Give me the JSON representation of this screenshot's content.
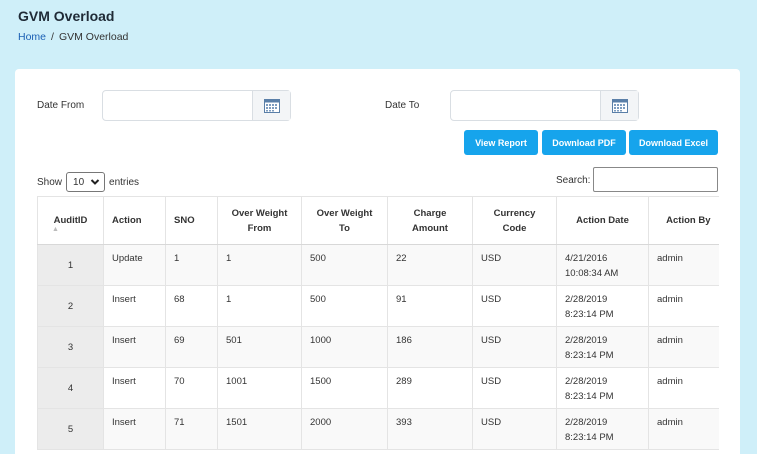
{
  "page": {
    "title": "GVM Overload"
  },
  "breadcrumb": {
    "home": "Home",
    "separator": "/",
    "current": "GVM Overload"
  },
  "filters": {
    "date_from_label": "Date From",
    "date_to_label": "Date To",
    "date_from_value": "",
    "date_to_value": ""
  },
  "buttons": {
    "view_report": "View Report",
    "download_pdf": "Download PDF",
    "download_excel": "Download Excel"
  },
  "colors": {
    "accent": "#16a4ec",
    "background": "#cfeff9"
  },
  "length_menu": {
    "show": "Show",
    "selected": "10",
    "entries": "entries"
  },
  "search": {
    "label": "Search:",
    "value": ""
  },
  "table": {
    "headers": [
      "AuditID",
      "Action",
      "SNO",
      "Over Weight From",
      "Over Weight To",
      "Charge Amount",
      "Currency Code",
      "Action Date",
      "Action By"
    ],
    "rows": [
      [
        "1",
        "Update",
        "1",
        "1",
        "500",
        "22",
        "USD",
        "4/21/2016 10:08:34 AM",
        "admin"
      ],
      [
        "2",
        "Insert",
        "68",
        "1",
        "500",
        "91",
        "USD",
        "2/28/2019 8:23:14 PM",
        "admin"
      ],
      [
        "3",
        "Insert",
        "69",
        "501",
        "1000",
        "186",
        "USD",
        "2/28/2019 8:23:14 PM",
        "admin"
      ],
      [
        "4",
        "Insert",
        "70",
        "1001",
        "1500",
        "289",
        "USD",
        "2/28/2019 8:23:14 PM",
        "admin"
      ],
      [
        "5",
        "Insert",
        "71",
        "1501",
        "2000",
        "393",
        "USD",
        "2/28/2019 8:23:14 PM",
        "admin"
      ]
    ]
  }
}
